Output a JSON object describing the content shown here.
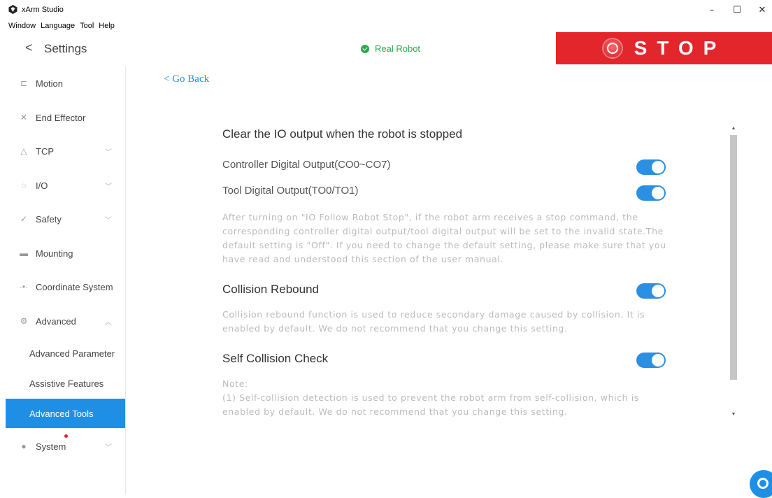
{
  "window": {
    "title": "xArm Studio",
    "controls": {
      "minimize": "–",
      "maximize": "☐",
      "close": "✕"
    }
  },
  "menubar": [
    "Window",
    "Language",
    "Tool",
    "Help"
  ],
  "header": {
    "back_glyph": "<",
    "title": "Settings",
    "status": "Real Robot",
    "status_color": "#2fa84f",
    "stop_label": "STOP",
    "stop_color": "#e3262b"
  },
  "sidebar": {
    "items": [
      {
        "label": "Motion",
        "icon": "motion-icon",
        "glyph": "⊏"
      },
      {
        "label": "End Effector",
        "icon": "gripper-icon",
        "glyph": "✕"
      },
      {
        "label": "TCP",
        "icon": "tcp-triangle-icon",
        "glyph": "△",
        "chevron": "﹀"
      },
      {
        "label": "I/O",
        "icon": "io-icon",
        "glyph": "◌",
        "chevron": "﹀"
      },
      {
        "label": "Safety",
        "icon": "safety-check-icon",
        "glyph": "✓",
        "chevron": "﹀"
      },
      {
        "label": "Mounting",
        "icon": "mounting-icon",
        "glyph": "▬"
      },
      {
        "label": "Coordinate System",
        "icon": "coordinate-icon",
        "glyph": "·•·"
      },
      {
        "label": "Advanced",
        "icon": "advanced-icon",
        "glyph": "⚙",
        "chevron": "︿"
      },
      {
        "label": "System",
        "icon": "system-icon",
        "glyph": "●",
        "chevron": "﹀"
      }
    ],
    "sub_items": [
      "Advanced Parameter",
      "Assistive Features",
      "Advanced Tools"
    ],
    "active_sub": "Advanced Tools",
    "accent": "#1f8fe6"
  },
  "main": {
    "go_back": "< Go Back",
    "io_section_title": "Clear the IO output when the robot is stopped",
    "controller_output_label": "Controller Digital Output(CO0~CO7)",
    "tool_output_label": "Tool Digital Output(TO0/TO1)",
    "io_description": "After turning on \"IO Follow Robot Stop\", if the robot arm receives a stop command, the corresponding controller digital output/tool digital output will be set to the invalid state.The default setting is \"Off\". If you need to change the default setting, please make sure that you have read and understood this section of the user manual.",
    "collision_title": "Collision Rebound",
    "collision_description": "Collision rebound function is used to reduce secondary damage caused by collision. It is enabled by default. We do not recommend that you change this setting.",
    "self_collision_title": "Self Collision Check",
    "note_label": "Note:",
    "self_collision_note": "(1) Self-collision detection is used to prevent the robot arm from self-collision, which is enabled by default. We do not recommend that you change this setting.",
    "toggles": {
      "controller_output": true,
      "tool_output": true,
      "collision_rebound": true,
      "self_collision": true
    },
    "toggle_color": "#2b8fe3"
  },
  "scrollbar": {
    "up": "▲",
    "down": "▼"
  }
}
